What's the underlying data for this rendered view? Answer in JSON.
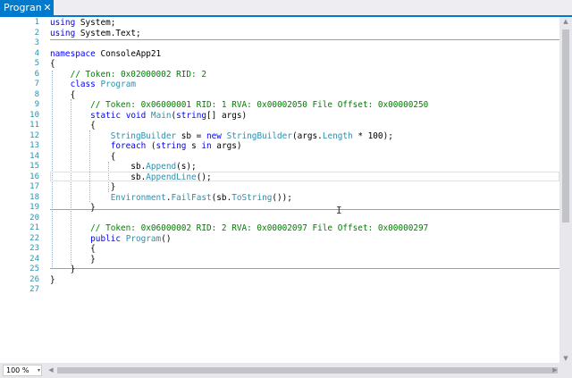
{
  "tab": {
    "title": "Program",
    "close": "✕"
  },
  "lines": [
    {
      "n": "1",
      "tokens": [
        {
          "t": "kw",
          "v": "using"
        },
        {
          "t": "",
          "v": " System;"
        }
      ]
    },
    {
      "n": "2",
      "tokens": [
        {
          "t": "kw",
          "v": "using"
        },
        {
          "t": "",
          "v": " System.Text;"
        }
      ]
    },
    {
      "n": "3",
      "tokens": []
    },
    {
      "n": "4",
      "tokens": [
        {
          "t": "kw",
          "v": "namespace"
        },
        {
          "t": "",
          "v": " ConsoleApp21"
        }
      ]
    },
    {
      "n": "5",
      "tokens": [
        {
          "t": "",
          "v": "{"
        }
      ]
    },
    {
      "n": "6",
      "tokens": [
        {
          "t": "",
          "v": "    "
        },
        {
          "t": "cm",
          "v": "// Token: 0x02000002 RID: 2"
        }
      ]
    },
    {
      "n": "7",
      "tokens": [
        {
          "t": "",
          "v": "    "
        },
        {
          "t": "kw",
          "v": "class"
        },
        {
          "t": "",
          "v": " "
        },
        {
          "t": "ty",
          "v": "Program"
        }
      ]
    },
    {
      "n": "8",
      "tokens": [
        {
          "t": "",
          "v": "    {"
        }
      ]
    },
    {
      "n": "9",
      "tokens": [
        {
          "t": "",
          "v": "        "
        },
        {
          "t": "cm",
          "v": "// Token: 0x06000001 RID: 1 RVA: 0x00002050 File Offset: 0x00000250"
        }
      ]
    },
    {
      "n": "10",
      "tokens": [
        {
          "t": "",
          "v": "        "
        },
        {
          "t": "kw",
          "v": "static"
        },
        {
          "t": "",
          "v": " "
        },
        {
          "t": "kw",
          "v": "void"
        },
        {
          "t": "",
          "v": " "
        },
        {
          "t": "ty",
          "v": "Main"
        },
        {
          "t": "",
          "v": "("
        },
        {
          "t": "kw",
          "v": "string"
        },
        {
          "t": "",
          "v": "[] args)"
        }
      ]
    },
    {
      "n": "11",
      "tokens": [
        {
          "t": "",
          "v": "        {"
        }
      ]
    },
    {
      "n": "12",
      "tokens": [
        {
          "t": "",
          "v": "            "
        },
        {
          "t": "ty",
          "v": "StringBuilder"
        },
        {
          "t": "",
          "v": " sb = "
        },
        {
          "t": "kw",
          "v": "new"
        },
        {
          "t": "",
          "v": " "
        },
        {
          "t": "ty",
          "v": "StringBuilder"
        },
        {
          "t": "",
          "v": "(args."
        },
        {
          "t": "ty",
          "v": "Length"
        },
        {
          "t": "",
          "v": " * 100);"
        }
      ]
    },
    {
      "n": "13",
      "tokens": [
        {
          "t": "",
          "v": "            "
        },
        {
          "t": "kw",
          "v": "foreach"
        },
        {
          "t": "",
          "v": " ("
        },
        {
          "t": "kw",
          "v": "string"
        },
        {
          "t": "",
          "v": " s "
        },
        {
          "t": "kw",
          "v": "in"
        },
        {
          "t": "",
          "v": " args)"
        }
      ]
    },
    {
      "n": "14",
      "tokens": [
        {
          "t": "",
          "v": "            {"
        }
      ]
    },
    {
      "n": "15",
      "tokens": [
        {
          "t": "",
          "v": "                sb."
        },
        {
          "t": "ty",
          "v": "Append"
        },
        {
          "t": "",
          "v": "(s);"
        }
      ]
    },
    {
      "n": "16",
      "tokens": [
        {
          "t": "",
          "v": "                sb."
        },
        {
          "t": "ty",
          "v": "AppendLine"
        },
        {
          "t": "",
          "v": "();"
        }
      ]
    },
    {
      "n": "17",
      "tokens": [
        {
          "t": "",
          "v": "            }"
        }
      ]
    },
    {
      "n": "18",
      "tokens": [
        {
          "t": "",
          "v": "            "
        },
        {
          "t": "ty",
          "v": "Environment"
        },
        {
          "t": "",
          "v": "."
        },
        {
          "t": "ty",
          "v": "FailFast"
        },
        {
          "t": "",
          "v": "(sb."
        },
        {
          "t": "ty",
          "v": "ToString"
        },
        {
          "t": "",
          "v": "());"
        }
      ]
    },
    {
      "n": "19",
      "tokens": [
        {
          "t": "",
          "v": "        }"
        }
      ]
    },
    {
      "n": "20",
      "tokens": []
    },
    {
      "n": "21",
      "tokens": [
        {
          "t": "",
          "v": "        "
        },
        {
          "t": "cm",
          "v": "// Token: 0x06000002 RID: 2 RVA: 0x00002097 File Offset: 0x00000297"
        }
      ]
    },
    {
      "n": "22",
      "tokens": [
        {
          "t": "",
          "v": "        "
        },
        {
          "t": "kw",
          "v": "public"
        },
        {
          "t": "",
          "v": " "
        },
        {
          "t": "ty",
          "v": "Program"
        },
        {
          "t": "",
          "v": "()"
        }
      ]
    },
    {
      "n": "23",
      "tokens": [
        {
          "t": "",
          "v": "        {"
        }
      ]
    },
    {
      "n": "24",
      "tokens": [
        {
          "t": "",
          "v": "        }"
        }
      ]
    },
    {
      "n": "25",
      "tokens": [
        {
          "t": "",
          "v": "    }"
        }
      ]
    },
    {
      "n": "26",
      "tokens": [
        {
          "t": "",
          "v": "}"
        }
      ]
    },
    {
      "n": "27",
      "tokens": []
    }
  ],
  "zoom": {
    "value": "100 %",
    "arrow": "▾"
  },
  "scroll": {
    "up": "▲",
    "down": "▼",
    "left": "◀",
    "right": "▶"
  },
  "colors": {
    "accent": "#007acc",
    "keyword": "#0000ff",
    "type": "#2b91af",
    "comment": "#008000",
    "line_number": "#2b91af"
  }
}
